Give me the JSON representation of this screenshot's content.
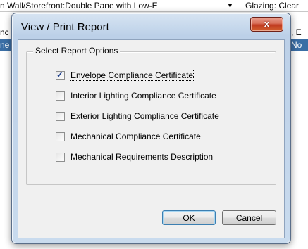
{
  "background": {
    "rows": [
      {
        "cells": [
          "n Wall/Storefront:Double Pane with Low-E",
          "▼",
          "Glazing: Clear"
        ]
      },
      {
        "cells": [
          "nc",
          ", E"
        ]
      },
      {
        "cells": [
          "ne",
          "No"
        ]
      }
    ]
  },
  "dialog": {
    "title": "View / Print Report",
    "close_glyph": "x",
    "group_label": "Select Report Options",
    "options": [
      {
        "label": "Envelope Compliance Certificate",
        "checked": true,
        "focused": true
      },
      {
        "label": "Interior Lighting Compliance Certificate",
        "checked": false,
        "focused": false
      },
      {
        "label": "Exterior Lighting Compliance Certificate",
        "checked": false,
        "focused": false
      },
      {
        "label": "Mechanical Compliance Certificate",
        "checked": false,
        "focused": false
      },
      {
        "label": "Mechanical Requirements Description",
        "checked": false,
        "focused": false
      }
    ],
    "ok_label": "OK",
    "cancel_label": "Cancel"
  },
  "colors": {
    "selection_row": "#3a6ea5",
    "close_button": "#c0391f",
    "check_mark": "#1d3f8d"
  }
}
